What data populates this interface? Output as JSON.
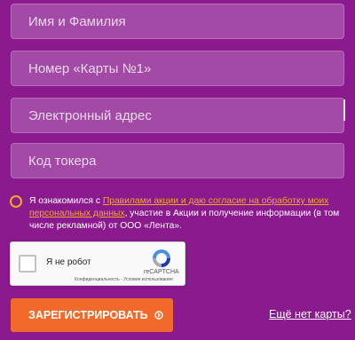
{
  "form": {
    "fields": [
      {
        "placeholder": "Имя и Фамилия",
        "value": ""
      },
      {
        "placeholder": "Номер «Карты №1»",
        "value": ""
      },
      {
        "placeholder": "Электронный адрес",
        "value": ""
      },
      {
        "placeholder": "Код токера",
        "value": ""
      }
    ]
  },
  "consent": {
    "text_before": "Я ознакомился с ",
    "link": "Правилами акции и даю согласие на обработку моих персональных данных",
    "text_after": ", участие в Акции и получение информации (в том числе рекламной) от ООО «Лента».",
    "accent_color": "#f7a823"
  },
  "recaptcha": {
    "label": "Я не робот",
    "brand": "reCAPTCHA",
    "links": "Конфиденциальность - Условия использования"
  },
  "actions": {
    "register_label": "ЗАРЕГИСТРИРОВАТЬ",
    "no_card_link": "Ещё нет карты?"
  },
  "colors": {
    "background": "#8a1a8e",
    "field_bg": "#a24aa6",
    "button": "#f26a2b",
    "accent": "#f7a823"
  },
  "icons": {
    "button_icon": "arrow-circle-right-icon",
    "radio": "radio-unchecked-icon",
    "captcha_logo": "recaptcha-logo-icon"
  }
}
